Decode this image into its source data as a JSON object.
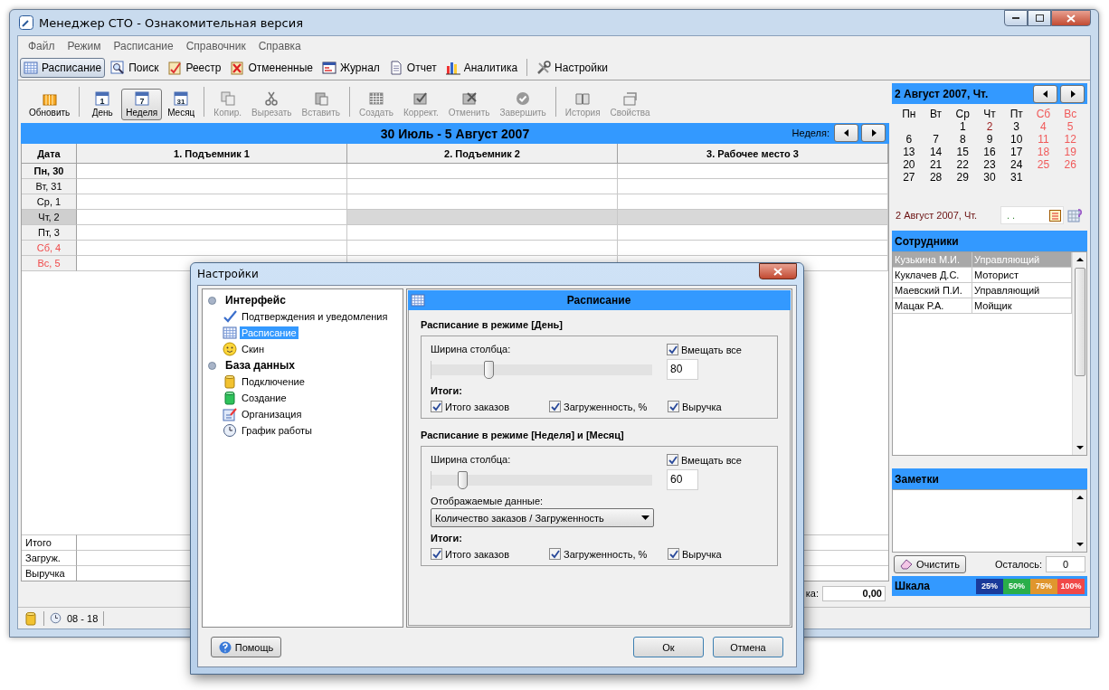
{
  "window": {
    "title": "Менеджер СТО - Ознакомительная версия"
  },
  "menu": [
    "Файл",
    "Режим",
    "Расписание",
    "Справочник",
    "Справка"
  ],
  "main_toolbar": [
    [
      {
        "label": "Расписание",
        "kind": "grid",
        "selected": true
      },
      {
        "label": "Поиск",
        "kind": "search",
        "selected": false
      },
      {
        "label": "Реестр",
        "kind": "clipboard",
        "selected": false
      },
      {
        "label": "Отмененные",
        "kind": "cancelled",
        "selected": false
      },
      {
        "label": "Журнал",
        "kind": "journal",
        "selected": false
      },
      {
        "label": "Отчет",
        "kind": "report",
        "selected": false
      },
      {
        "label": "Аналитика",
        "kind": "chart",
        "selected": false
      }
    ],
    [
      {
        "label": "Настройки",
        "kind": "tools",
        "selected": false
      }
    ]
  ],
  "schedule_toolbar": [
    [
      {
        "label": "Обновить",
        "kind": "refresh",
        "selected": false,
        "disabled": false
      }
    ],
    [
      {
        "label": "День",
        "kind": "calendar",
        "icon_text": "1",
        "selected": false,
        "disabled": false
      },
      {
        "label": "Неделя",
        "kind": "calendar",
        "icon_text": "7",
        "selected": true,
        "disabled": false
      },
      {
        "label": "Месяц",
        "kind": "calendar",
        "icon_text": "31",
        "selected": false,
        "disabled": false
      }
    ],
    [
      {
        "label": "Копир.",
        "kind": "copy",
        "selected": false,
        "disabled": true
      },
      {
        "label": "Вырезать",
        "kind": "cut",
        "selected": false,
        "disabled": true
      },
      {
        "label": "Вставить",
        "kind": "paste",
        "selected": false,
        "disabled": true
      }
    ],
    [
      {
        "label": "Создать",
        "kind": "table",
        "selected": false,
        "disabled": true
      },
      {
        "label": "Коррект.",
        "kind": "tablecheck",
        "selected": false,
        "disabled": true
      },
      {
        "label": "Отменить",
        "kind": "tablecross",
        "selected": false,
        "disabled": true
      },
      {
        "label": "Завершить",
        "kind": "finish",
        "selected": false,
        "disabled": true
      }
    ],
    [
      {
        "label": "История",
        "kind": "book",
        "selected": false,
        "disabled": true
      },
      {
        "label": "Свойства",
        "kind": "props",
        "selected": false,
        "disabled": true
      }
    ]
  ],
  "schedule": {
    "title": "30 Июль - 5 Август 2007",
    "period_label": "Неделя:",
    "columns": [
      "Дата",
      "1. Подъемник 1",
      "2. Подъемник 2",
      "3. Рабочее место 3"
    ],
    "rows": [
      {
        "day": "Пн, 30",
        "bold": true,
        "weekend": false,
        "selected": false
      },
      {
        "day": "Вт, 31",
        "bold": false,
        "weekend": false,
        "selected": false
      },
      {
        "day": "Ср, 1",
        "bold": false,
        "weekend": false,
        "selected": false
      },
      {
        "day": "Чт, 2",
        "bold": false,
        "weekend": false,
        "selected": true
      },
      {
        "day": "Пт, 3",
        "bold": false,
        "weekend": false,
        "selected": false
      },
      {
        "day": "Сб, 4",
        "bold": false,
        "weekend": true,
        "selected": false
      },
      {
        "day": "Вс, 5",
        "bold": false,
        "weekend": true,
        "selected": false
      }
    ],
    "totals": [
      "Итого",
      "Загруж.",
      "Выручка"
    ],
    "sum_label": "ка:",
    "sum_value": "0,00"
  },
  "calendar": {
    "title": "2 Август 2007, Чт.",
    "weekdays": [
      {
        "label": "Пн",
        "weekend": false
      },
      {
        "label": "Вт",
        "weekend": false
      },
      {
        "label": "Ср",
        "weekend": false
      },
      {
        "label": "Чт",
        "weekend": false
      },
      {
        "label": "Пт",
        "weekend": false
      },
      {
        "label": "Сб",
        "weekend": true
      },
      {
        "label": "Вс",
        "weekend": true
      }
    ],
    "weeks": [
      [
        {
          "day": "1",
          "weekend": false,
          "selected": false
        },
        {
          "day": "2",
          "weekend": false,
          "selected": true
        },
        {
          "day": "3",
          "weekend": false,
          "selected": false
        },
        {
          "day": "4",
          "weekend": true,
          "selected": false
        },
        {
          "day": "5",
          "weekend": true,
          "selected": false
        }
      ],
      [
        {
          "day": "6",
          "weekend": false,
          "selected": false
        },
        {
          "day": "7",
          "weekend": false,
          "selected": false
        },
        {
          "day": "8",
          "weekend": false,
          "selected": false
        },
        {
          "day": "9",
          "weekend": false,
          "selected": false
        },
        {
          "day": "10",
          "weekend": false,
          "selected": false
        },
        {
          "day": "11",
          "weekend": true,
          "selected": false
        },
        {
          "day": "12",
          "weekend": true,
          "selected": false
        }
      ],
      [
        {
          "day": "13",
          "weekend": false,
          "selected": false
        },
        {
          "day": "14",
          "weekend": false,
          "selected": false
        },
        {
          "day": "15",
          "weekend": false,
          "selected": false
        },
        {
          "day": "16",
          "weekend": false,
          "selected": false
        },
        {
          "day": "17",
          "weekend": false,
          "selected": false
        },
        {
          "day": "18",
          "weekend": true,
          "selected": false
        },
        {
          "day": "19",
          "weekend": true,
          "selected": false
        }
      ],
      [
        {
          "day": "20",
          "weekend": false,
          "selected": false
        },
        {
          "day": "21",
          "weekend": false,
          "selected": false
        },
        {
          "day": "22",
          "weekend": false,
          "selected": false
        },
        {
          "day": "23",
          "weekend": false,
          "selected": false
        },
        {
          "day": "24",
          "weekend": false,
          "selected": false
        },
        {
          "day": "25",
          "weekend": true,
          "selected": false
        },
        {
          "day": "26",
          "weekend": true,
          "selected": false
        }
      ],
      [
        {
          "day": "27",
          "weekend": false,
          "selected": false
        },
        {
          "day": "28",
          "weekend": false,
          "selected": false
        },
        {
          "day": "29",
          "weekend": false,
          "selected": false
        },
        {
          "day": "30",
          "weekend": false,
          "selected": false
        },
        {
          "day": "31",
          "weekend": false,
          "selected": false
        }
      ]
    ],
    "footer_date": "2 Август 2007, Чт.",
    "date_field": ". ."
  },
  "employees": {
    "title": "Сотрудники",
    "rows": [
      {
        "name": "Кузькина М.И.",
        "role": "Управляющий",
        "selected": true
      },
      {
        "name": "Куклачев Д.С.",
        "role": "Моторист",
        "selected": false
      },
      {
        "name": "Маевский П.И.",
        "role": "Управляющий",
        "selected": false
      },
      {
        "name": "Мацак Р.А.",
        "role": "Мойщик",
        "selected": false
      }
    ]
  },
  "notes": {
    "title": "Заметки",
    "clear_button": "Очистить",
    "remaining_label": "Осталось:",
    "remaining_value": "0"
  },
  "scale": {
    "label": "Шкала",
    "items": [
      {
        "label": "25%",
        "color": "#1a3a9a"
      },
      {
        "label": "50%",
        "color": "#2aae4a"
      },
      {
        "label": "75%",
        "color": "#e0962e"
      },
      {
        "label": "100%",
        "color": "#f04848"
      }
    ]
  },
  "status_bar": {
    "hours": "08 - 18"
  },
  "dialog": {
    "title": "Настройки",
    "tree": [
      {
        "label": "Интерфейс",
        "children": [
          {
            "label": "Подтверждения и уведомления",
            "kind": "check",
            "selected": false
          },
          {
            "label": "Расписание",
            "kind": "grid",
            "selected": true
          },
          {
            "label": "Скин",
            "kind": "smile",
            "selected": false
          }
        ]
      },
      {
        "label": "База данных",
        "children": [
          {
            "label": "Подключение",
            "kind": "db",
            "selected": false
          },
          {
            "label": "Создание",
            "kind": "dbnew",
            "selected": false
          },
          {
            "label": "Организация",
            "kind": "org",
            "selected": false
          },
          {
            "label": "График работы",
            "kind": "clock",
            "selected": false
          }
        ]
      }
    ],
    "panel_title": "Расписание",
    "sections": [
      {
        "title": "Расписание в режиме [День]",
        "width_label": "Ширина столбца:",
        "level": 0.26,
        "width_value": "80",
        "fit_all": {
          "label": "Вмещать все",
          "checked": true
        },
        "totals_label": "Итоги:",
        "totals": [
          {
            "label": "Итого заказов",
            "checked": true
          },
          {
            "label": "Загруженность, %",
            "checked": true
          },
          {
            "label": "Выручка",
            "checked": true
          }
        ]
      },
      {
        "title": "Расписание в режиме [Неделя] и [Месяц]",
        "width_label": "Ширина столбца:",
        "level": 0.14,
        "width_value": "60",
        "fit_all": {
          "label": "Вмещать все",
          "checked": true
        },
        "display": {
          "label": "Отображаемые данные:",
          "value": "Количество заказов / Загруженность"
        },
        "totals_label": "Итоги:",
        "totals": [
          {
            "label": "Итого заказов",
            "checked": true
          },
          {
            "label": "Загруженность, %",
            "checked": true
          },
          {
            "label": "Выручка",
            "checked": true
          }
        ]
      }
    ],
    "help_button": "Помощь",
    "ok_button": "Ок",
    "cancel_button": "Отмена"
  }
}
